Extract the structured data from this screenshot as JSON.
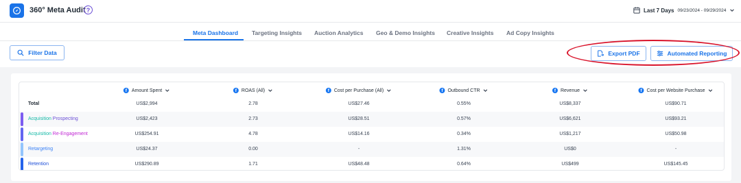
{
  "header": {
    "title": "360° Meta Audit",
    "help_icon": "question-circle-icon",
    "date_label": "Last 7 Days",
    "date_range": "09/23/2024 - 09/29/2024"
  },
  "tabs": [
    {
      "label": "Meta Dashboard",
      "active": true
    },
    {
      "label": "Targeting Insights",
      "active": false
    },
    {
      "label": "Auction Analytics",
      "active": false
    },
    {
      "label": "Geo & Demo Insights",
      "active": false
    },
    {
      "label": "Creative Insights",
      "active": false
    },
    {
      "label": "Ad Copy Insights",
      "active": false
    }
  ],
  "actions": {
    "filter_label": "Filter Data",
    "export_label": "Export PDF",
    "auto_label": "Automated Reporting"
  },
  "colors": {
    "accent": "#1a73e8",
    "annotation": "#d9142b",
    "teal": "#14b8a6",
    "purple": "#a855f7"
  },
  "table": {
    "columns": [
      "Amount Spent",
      "ROAS (All)",
      "Cost per Purchase (All)",
      "Outbound CTR",
      "Revenue",
      "Cost per Website Purchase"
    ],
    "rows": [
      {
        "label_parts": [
          {
            "text": "Total",
            "color": "#1f2933"
          }
        ],
        "bar": "",
        "values": [
          "US$2,994",
          "2.78",
          "US$27.46",
          "0.55%",
          "US$8,337",
          "US$90.71"
        ]
      },
      {
        "label_parts": [
          {
            "text": "Acquisition",
            "color": "#14b8a6"
          },
          {
            "text": " Prospecting",
            "color": "#6b4fd6"
          }
        ],
        "bar": "#7c5cf0",
        "values": [
          "US$2,423",
          "2.73",
          "US$28.51",
          "0.57%",
          "US$6,621",
          "US$93.21"
        ]
      },
      {
        "label_parts": [
          {
            "text": "Acquisition",
            "color": "#14b8a6"
          },
          {
            "text": " Re-Engagement",
            "color": "#c026d3"
          }
        ],
        "bar": "#6366f1",
        "values": [
          "US$254.91",
          "4.78",
          "US$14.16",
          "0.34%",
          "US$1,217",
          "US$50.98"
        ]
      },
      {
        "label_parts": [
          {
            "text": "Retargeting",
            "color": "#3b82f6"
          }
        ],
        "bar": "#93c5fd",
        "values": [
          "US$24.37",
          "0.00",
          "-",
          "1.31%",
          "US$0",
          "-"
        ]
      },
      {
        "label_parts": [
          {
            "text": "Retention",
            "color": "#1d4ed8"
          }
        ],
        "bar": "#2563eb",
        "values": [
          "US$290.89",
          "1.71",
          "US$48.48",
          "0.64%",
          "US$499",
          "US$145.45"
        ]
      }
    ]
  }
}
